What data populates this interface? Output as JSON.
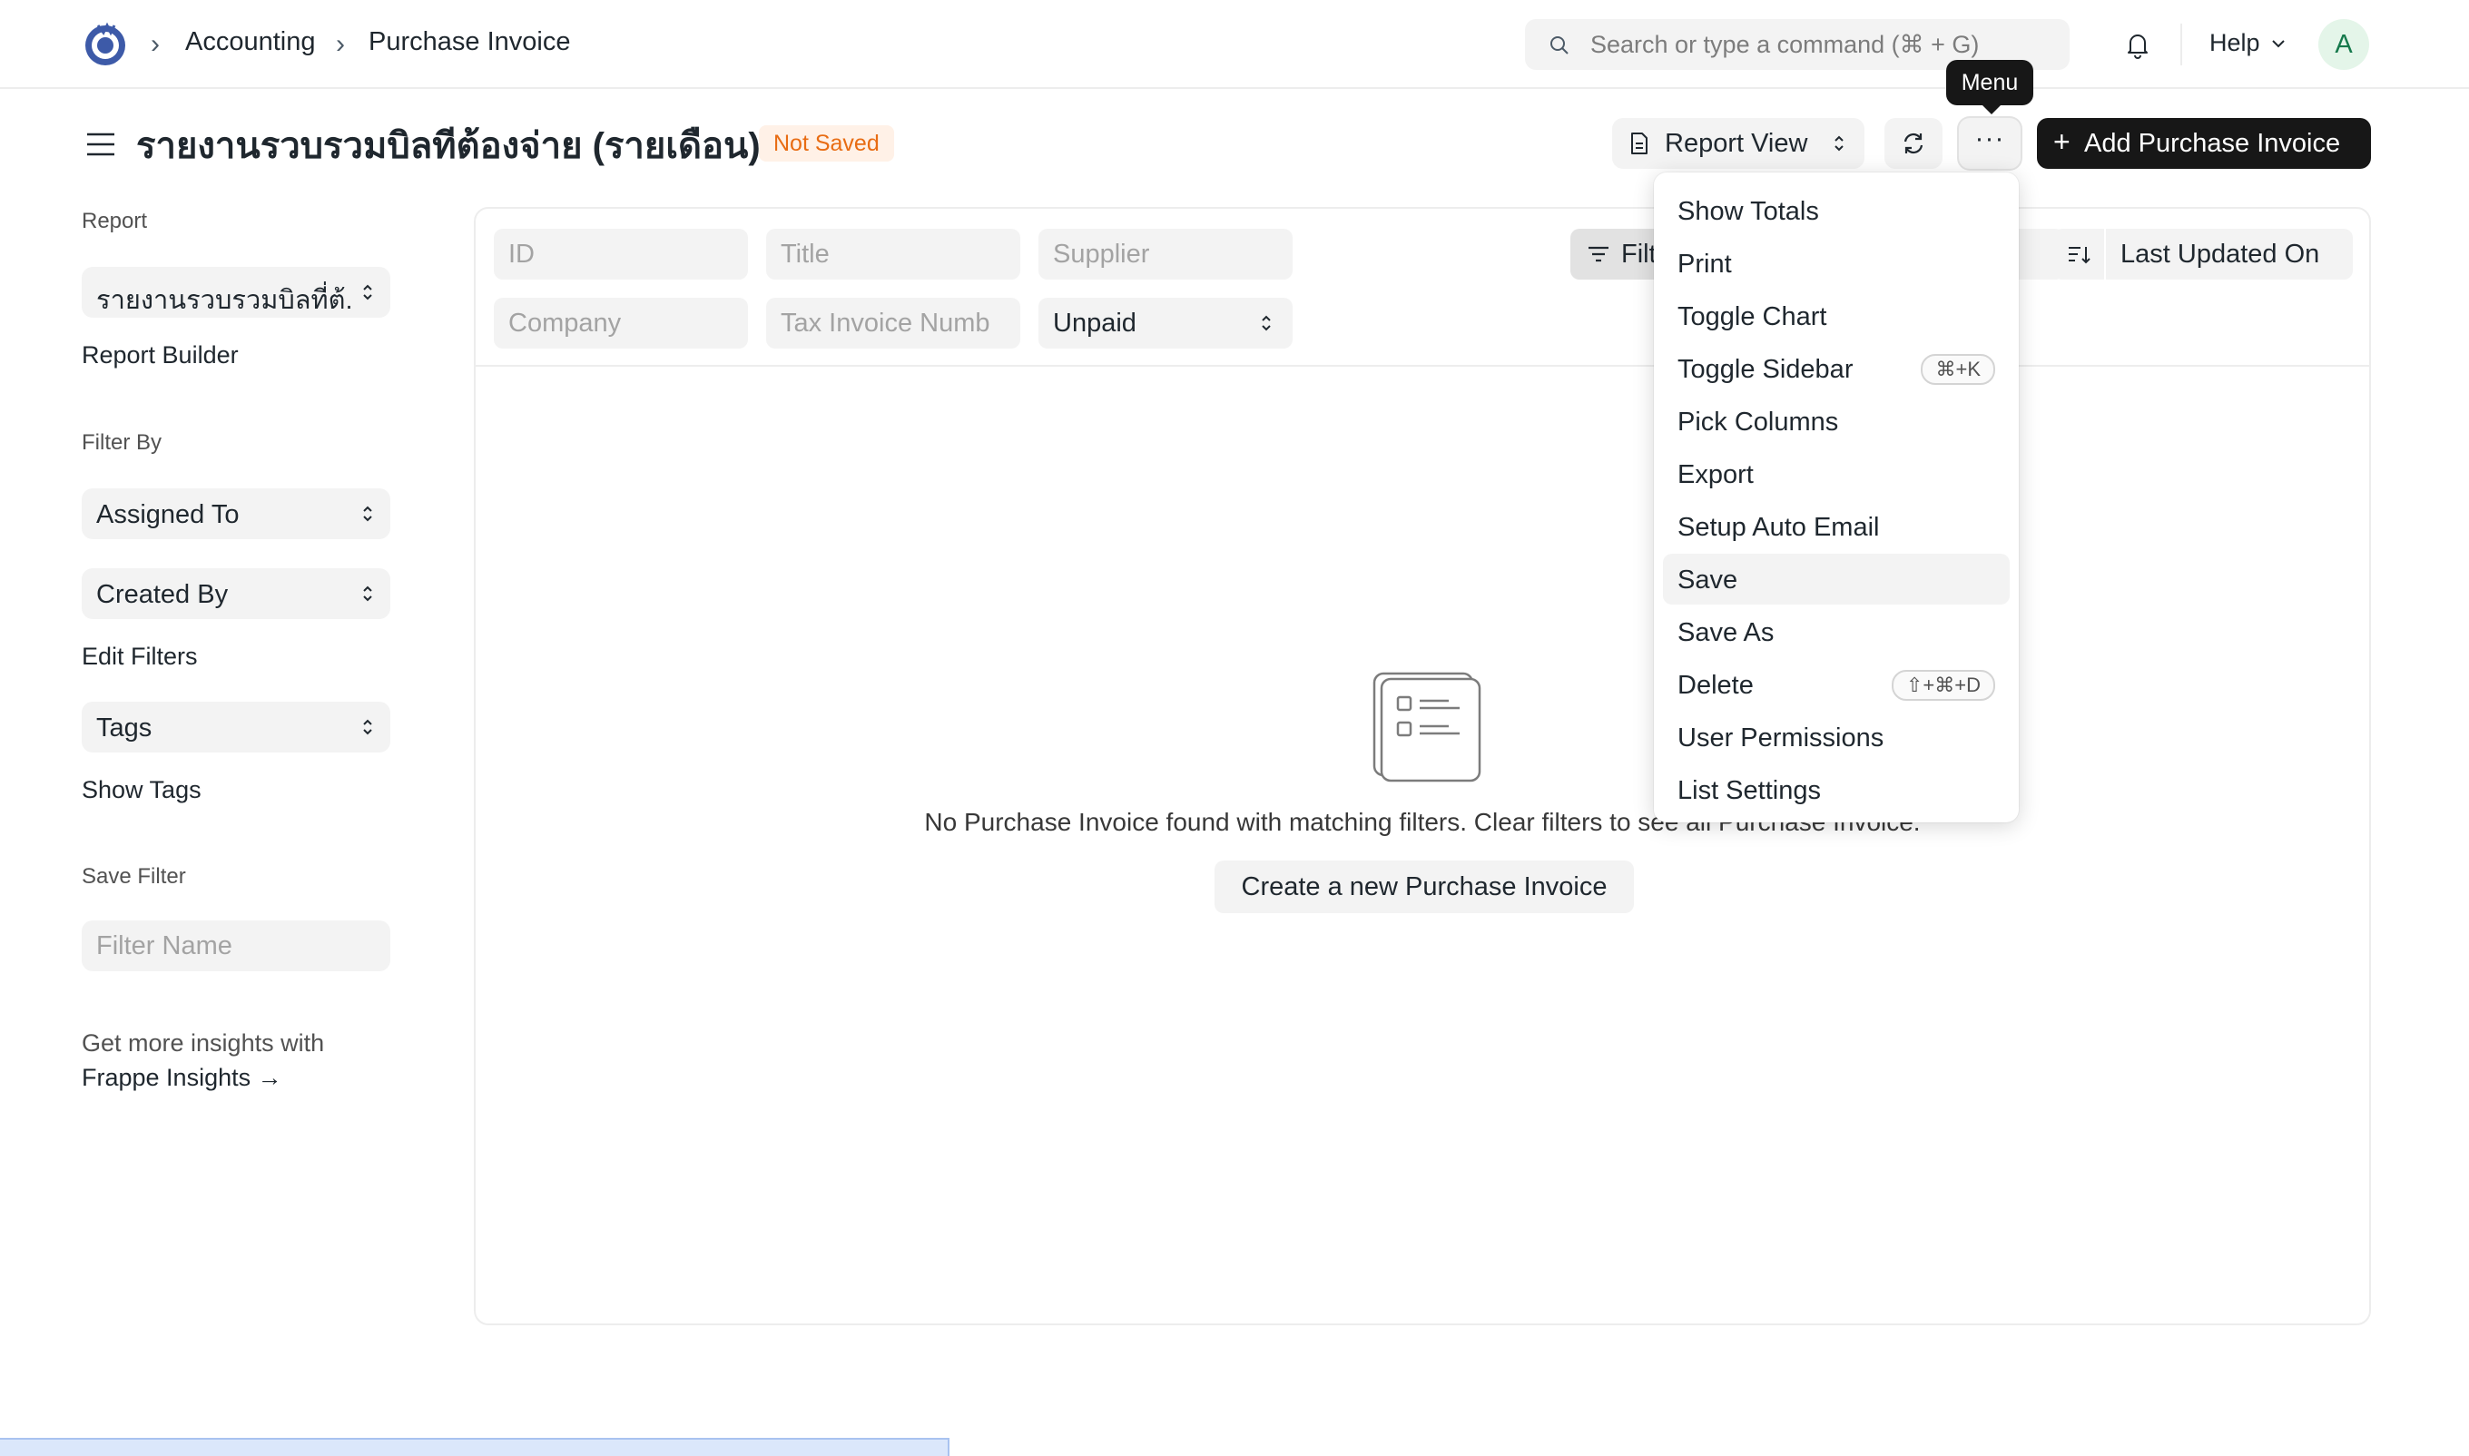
{
  "navbar": {
    "breadcrumbs": [
      "Accounting",
      "Purchase Invoice"
    ],
    "search_placeholder": "Search or type a command (⌘ + G)",
    "help_label": "Help",
    "avatar_initial": "A"
  },
  "page": {
    "title": "รายงานรวบรวมบิลทีต้องจ่าย (รายเดือน)",
    "status_badge": "Not Saved",
    "report_view_label": "Report View",
    "menu_tooltip": "Menu",
    "menu_button_label": "···",
    "add_button_label": "Add Purchase Invoice"
  },
  "sidebar": {
    "report_heading": "Report",
    "report_select_value": "รายงานรวบรวมบิลที่ต้...",
    "report_builder_label": "Report Builder",
    "filter_by_heading": "Filter By",
    "assigned_to_label": "Assigned To",
    "created_by_label": "Created By",
    "edit_filters_label": "Edit Filters",
    "tags_label": "Tags",
    "show_tags_label": "Show Tags",
    "save_filter_heading": "Save Filter",
    "filter_name_placeholder": "Filter Name",
    "insights_text": "Get more insights with",
    "insights_link": "Frappe Insights →"
  },
  "filters": {
    "id_placeholder": "ID",
    "title_placeholder": "Title",
    "supplier_placeholder": "Supplier",
    "company_placeholder": "Company",
    "tax_invoice_placeholder": "Tax Invoice Numb",
    "status_value": "Unpaid",
    "filter_button_label": "Filter",
    "sort_label": "Last Updated On"
  },
  "empty_state": {
    "message": "No Purchase Invoice found with matching filters. Clear filters to see all Purchase Invoice.",
    "create_button_label": "Create a new Purchase Invoice"
  },
  "dropdown": {
    "items": [
      {
        "label": "Show Totals",
        "shortcut": ""
      },
      {
        "label": "Print",
        "shortcut": ""
      },
      {
        "label": "Toggle Chart",
        "shortcut": ""
      },
      {
        "label": "Toggle Sidebar",
        "shortcut": "⌘+K"
      },
      {
        "label": "Pick Columns",
        "shortcut": ""
      },
      {
        "label": "Export",
        "shortcut": ""
      },
      {
        "label": "Setup Auto Email",
        "shortcut": ""
      },
      {
        "label": "Save",
        "shortcut": ""
      },
      {
        "label": "Save As",
        "shortcut": ""
      },
      {
        "label": "Delete",
        "shortcut": "⇧+⌘+D"
      },
      {
        "label": "User Permissions",
        "shortcut": ""
      },
      {
        "label": "List Settings",
        "shortcut": ""
      }
    ],
    "active_item": "Save"
  },
  "colors": {
    "primary_button_bg": "#171717",
    "badge_text": "#e86c13",
    "badge_bg": "#fff1e7",
    "avatar_bg": "#e4f5e9",
    "avatar_text": "#16794c"
  },
  "icons": [
    "app-logo-icon",
    "chevron-right-icon",
    "search-icon",
    "bell-icon",
    "chevron-down-icon",
    "hamburger-icon",
    "doc-icon",
    "updown-icon",
    "refresh-icon",
    "filter-icon",
    "sort-icon",
    "empty-list-icon"
  ]
}
